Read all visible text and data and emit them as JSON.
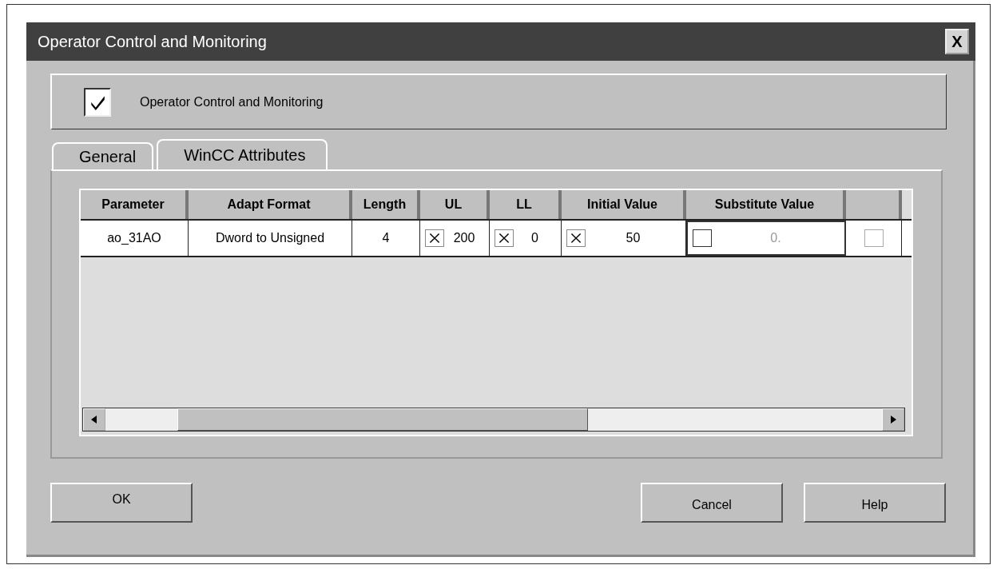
{
  "window": {
    "title": "Operator Control and Monitoring",
    "close_label": "X"
  },
  "enable": {
    "label": "Operator Control and Monitoring",
    "checked": true
  },
  "tabs": [
    {
      "label": "General",
      "selected": false
    },
    {
      "label": "WinCC Attributes",
      "selected": true
    }
  ],
  "table": {
    "columns": [
      "Parameter",
      "Adapt Format",
      "Length",
      "UL",
      "LL",
      "Initial Value",
      "Substitute Value",
      ""
    ],
    "rows": [
      [
        {
          "kind": "text",
          "text": "ao_31AO"
        },
        {
          "kind": "text",
          "text": "Dword to Unsigned"
        },
        {
          "kind": "text",
          "text": "4"
        },
        {
          "kind": "check",
          "checked": true,
          "text": "200"
        },
        {
          "kind": "check",
          "checked": true,
          "text": "0"
        },
        {
          "kind": "check",
          "checked": true,
          "text": "50"
        },
        {
          "kind": "check",
          "checked": false,
          "text": "0.",
          "disabled": true,
          "focused": true
        },
        {
          "kind": "check",
          "checked": false,
          "disabled": true
        }
      ]
    ]
  },
  "buttons": {
    "ok": "OK",
    "cancel": "Cancel",
    "help": "Help"
  }
}
